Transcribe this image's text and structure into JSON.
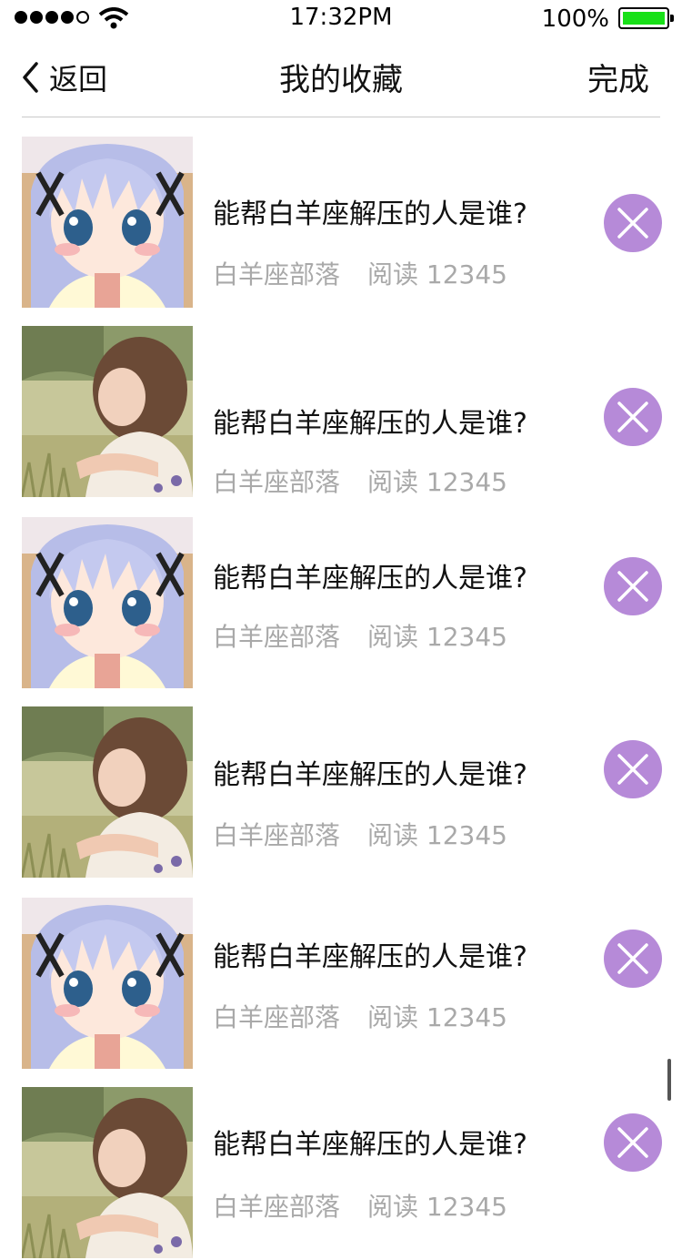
{
  "status_bar": {
    "time": "17:32PM",
    "battery_percent": "100%",
    "battery_level": 1.0,
    "battery_color": "#18e018",
    "signal_bars": 5,
    "signal_filled": 4
  },
  "nav": {
    "back_label": "返回",
    "title": "我的收藏",
    "done_label": "完成",
    "back_icon": "chevron-left-icon"
  },
  "accent_color": "#b68ad8",
  "items": [
    {
      "title": "能帮白羊座解压的人是谁?",
      "source": "白羊座部落",
      "reads": "阅读 12345",
      "thumb": "anime-girl"
    },
    {
      "title": "能帮白羊座解压的人是谁?",
      "source": "白羊座部落",
      "reads": "阅读 12345",
      "thumb": "girl-in-field"
    },
    {
      "title": "能帮白羊座解压的人是谁?",
      "source": "白羊座部落",
      "reads": "阅读 12345",
      "thumb": "anime-girl"
    },
    {
      "title": "能帮白羊座解压的人是谁?",
      "source": "白羊座部落",
      "reads": "阅读 12345",
      "thumb": "girl-in-field"
    },
    {
      "title": "能帮白羊座解压的人是谁?",
      "source": "白羊座部落",
      "reads": "阅读 12345",
      "thumb": "anime-girl"
    },
    {
      "title": "能帮白羊座解压的人是谁?",
      "source": "白羊座部落",
      "reads": "阅读 12345",
      "thumb": "girl-in-field"
    }
  ]
}
